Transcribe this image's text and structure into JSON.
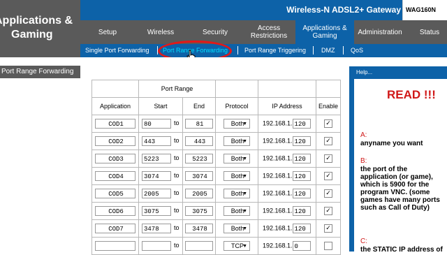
{
  "brand": {
    "title_line1": "Applications &",
    "title_line2": "Gaming"
  },
  "header": {
    "gateway": "Wireless-N ADSL2+ Gateway",
    "model": "WAG160N"
  },
  "tabs": [
    {
      "label": "Setup"
    },
    {
      "label": "Wireless"
    },
    {
      "label": "Security"
    },
    {
      "label": "Access Restrictions"
    },
    {
      "label": "Applications & Gaming"
    },
    {
      "label": "Administration"
    },
    {
      "label": "Status"
    }
  ],
  "subtabs": [
    {
      "label": "Single Port Forwarding"
    },
    {
      "label": "Port Range Forwarding"
    },
    {
      "label": "Port Range Triggering"
    },
    {
      "label": "DMZ"
    },
    {
      "label": "QoS"
    }
  ],
  "section": {
    "label": "Port Range Forwarding"
  },
  "table": {
    "headers": {
      "port_range": "Port Range",
      "application": "Application",
      "start": "Start",
      "end": "End",
      "protocol": "Protocol",
      "ip": "IP Address",
      "enable": "Enable"
    },
    "to_label": "to",
    "ip_prefix": "192.168.1.",
    "rows": [
      {
        "app": "COD1",
        "start": "80",
        "end": "81",
        "protocol": "Both",
        "ip_last": "120",
        "enabled": true
      },
      {
        "app": "COD2",
        "start": "443",
        "end": "443",
        "protocol": "Both",
        "ip_last": "120",
        "enabled": true
      },
      {
        "app": "COD3",
        "start": "5223",
        "end": "5223",
        "protocol": "Both",
        "ip_last": "120",
        "enabled": true
      },
      {
        "app": "COD4",
        "start": "3074",
        "end": "3074",
        "protocol": "Both",
        "ip_last": "120",
        "enabled": true
      },
      {
        "app": "COD5",
        "start": "2005",
        "end": "2005",
        "protocol": "Both",
        "ip_last": "120",
        "enabled": true
      },
      {
        "app": "COD6",
        "start": "3075",
        "end": "3075",
        "protocol": "Both",
        "ip_last": "120",
        "enabled": true
      },
      {
        "app": "COD7",
        "start": "3478",
        "end": "3478",
        "protocol": "Both",
        "ip_last": "120",
        "enabled": true
      },
      {
        "app": "",
        "start": "",
        "end": "",
        "protocol": "TCP",
        "ip_last": "0",
        "enabled": false
      }
    ]
  },
  "help": {
    "title": "Help...",
    "read": "READ !!!",
    "a_label": "A:",
    "a_text": "anyname you want",
    "b_label": "B:",
    "b_text": "the port of the application (or game), which is 5900 for the program VNC. (some games have many ports such as Call of Duty)",
    "c_label": "C:",
    "c_text": "the STATIC IP address of"
  },
  "colors": {
    "blue": "#0d62a8",
    "gray": "#5a5a5a",
    "active_sub": "#00e0ff",
    "annotation": "#e31818",
    "read": "#d01818"
  }
}
